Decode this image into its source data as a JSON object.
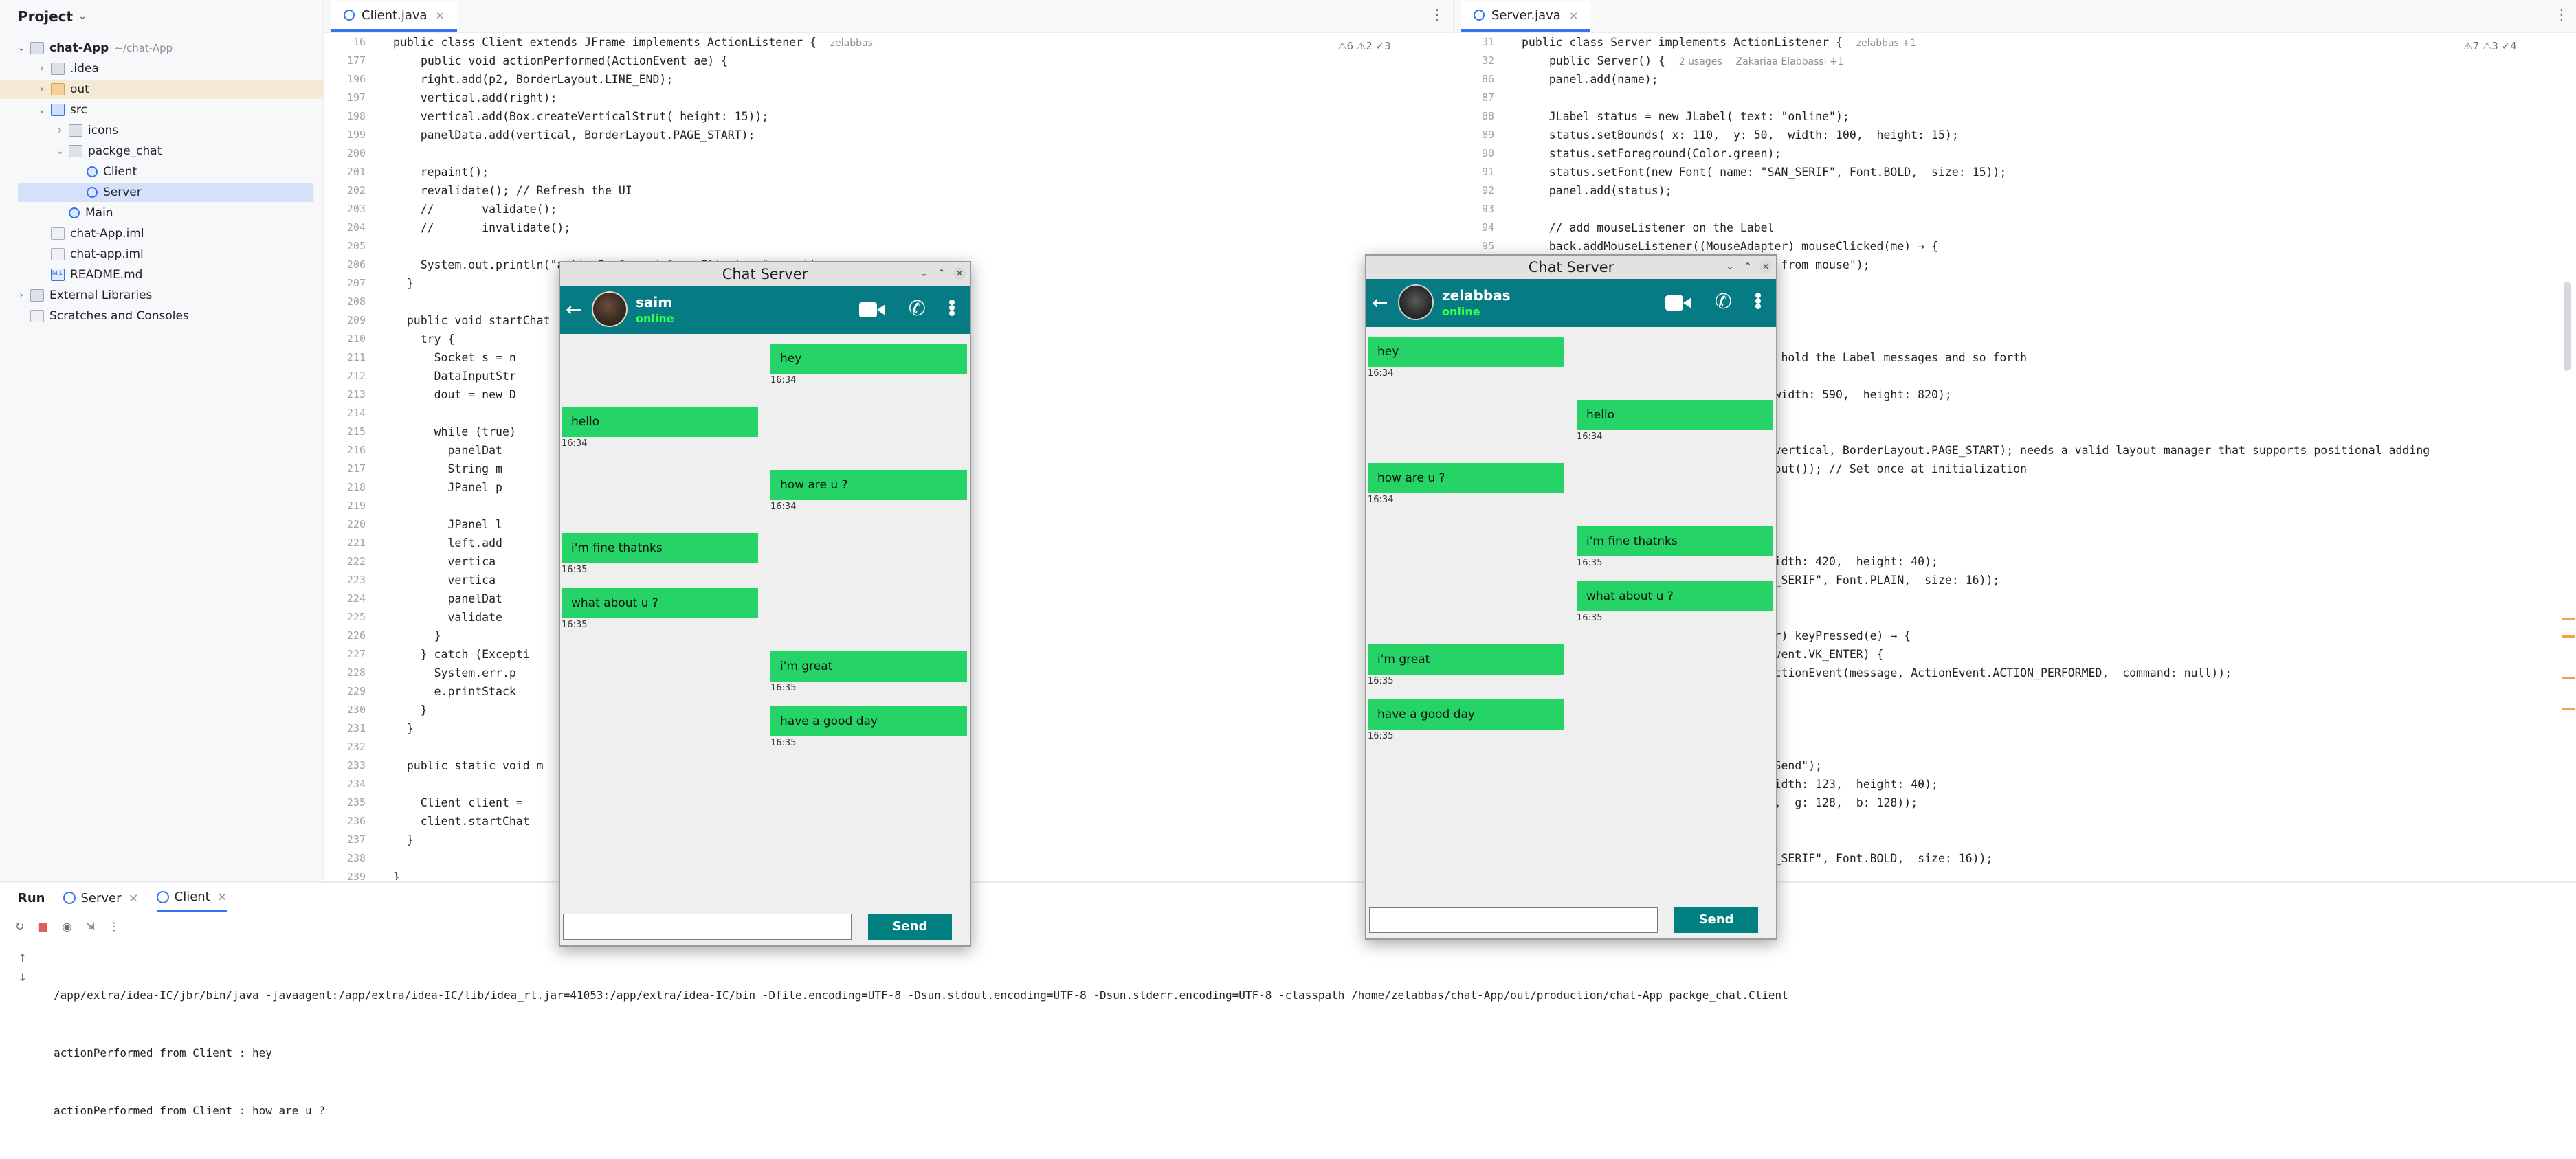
{
  "project": {
    "title": "Project",
    "items": [
      {
        "label": "chat-App",
        "hint": "~/chat-App"
      },
      {
        "label": ".idea"
      },
      {
        "label": "out"
      },
      {
        "label": "src"
      },
      {
        "label": "icons"
      },
      {
        "label": "packge_chat"
      },
      {
        "label": "Client"
      },
      {
        "label": "Server"
      },
      {
        "label": "Main"
      },
      {
        "label": "chat-App.iml"
      },
      {
        "label": "chat-app.iml"
      },
      {
        "label": "README.md"
      },
      {
        "label": "External Libraries"
      },
      {
        "label": "Scratches and Consoles"
      }
    ]
  },
  "left_editor": {
    "tab": "Client.java",
    "class_line": "public class Client extends JFrame implements ActionListener {",
    "class_author": "zelabbas",
    "method_line": "public void actionPerformed(ActionEvent ae) {",
    "inspections": "⚠6  ⚠2  ✓3",
    "lines": [
      {
        "n": "196",
        "t": "    right.add(p2, BorderLayout.LINE_END);"
      },
      {
        "n": "197",
        "t": "    vertical.add(right);"
      },
      {
        "n": "198",
        "t": "    vertical.add(Box.createVerticalStrut( height: 15));"
      },
      {
        "n": "199",
        "t": "    panelData.add(vertical, BorderLayout.PAGE_START);"
      },
      {
        "n": "200",
        "t": ""
      },
      {
        "n": "201",
        "t": "    repaint();"
      },
      {
        "n": "202",
        "t": "    revalidate(); // Refresh the UI"
      },
      {
        "n": "203",
        "t": "    //       validate();"
      },
      {
        "n": "204",
        "t": "    //       invalidate();"
      },
      {
        "n": "205",
        "t": ""
      },
      {
        "n": "206",
        "t": "    System.out.println(\"actionPerformed from Client : \" + out);"
      },
      {
        "n": "207",
        "t": "  }"
      },
      {
        "n": "208",
        "t": ""
      },
      {
        "n": "209",
        "t": "  public void startChat"
      },
      {
        "n": "210",
        "t": "    try {"
      },
      {
        "n": "211",
        "t": "      Socket s = n"
      },
      {
        "n": "212",
        "t": "      DataInputStr"
      },
      {
        "n": "213",
        "t": "      dout = new D"
      },
      {
        "n": "214",
        "t": ""
      },
      {
        "n": "215",
        "t": "      while (true)"
      },
      {
        "n": "216",
        "t": "        panelDat"
      },
      {
        "n": "217",
        "t": "        String m"
      },
      {
        "n": "218",
        "t": "        JPanel p"
      },
      {
        "n": "219",
        "t": ""
      },
      {
        "n": "220",
        "t": "        JPanel l"
      },
      {
        "n": "221",
        "t": "        left.add"
      },
      {
        "n": "222",
        "t": "        vertica"
      },
      {
        "n": "223",
        "t": "        vertica"
      },
      {
        "n": "224",
        "t": "        panelDat"
      },
      {
        "n": "225",
        "t": "        validate"
      },
      {
        "n": "226",
        "t": "      }"
      },
      {
        "n": "227",
        "t": "    } catch (Excepti"
      },
      {
        "n": "228",
        "t": "      System.err.p"
      },
      {
        "n": "229",
        "t": "      e.printStack"
      },
      {
        "n": "230",
        "t": "    }"
      },
      {
        "n": "231",
        "t": "  }"
      },
      {
        "n": "232",
        "t": ""
      },
      {
        "n": "233",
        "t": "  public static void m"
      },
      {
        "n": "234",
        "t": ""
      },
      {
        "n": "235",
        "t": "    Client client = "
      },
      {
        "n": "236",
        "t": "    client.startChat"
      },
      {
        "n": "237",
        "t": "  }"
      },
      {
        "n": "238",
        "t": ""
      },
      {
        "n": "239",
        "t": "}"
      }
    ]
  },
  "right_editor": {
    "tab": "Server.java",
    "class_line": "public class Server implements ActionListener {",
    "class_author": "zelabbas +1",
    "method_line": "public Server() {",
    "method_usages": "2 usages",
    "method_author": "Zakariaa Elabbassi +1",
    "inspections": "⚠7  ⚠3  ✓4",
    "lines": [
      {
        "n": "86",
        "t": "    panel.add(name);"
      },
      {
        "n": "87",
        "t": ""
      },
      {
        "n": "88",
        "t": "    JLabel status = new JLabel( text: \"online\");"
      },
      {
        "n": "89",
        "t": "    status.setBounds( x: 110,  y: 50,  width: 100,  height: 15);"
      },
      {
        "n": "90",
        "t": "    status.setForeground(Color.green);"
      },
      {
        "n": "91",
        "t": "    status.setFont(new Font( name: \"SAN_SERIF\", Font.BOLD,  size: 15));"
      },
      {
        "n": "92",
        "t": "    panel.add(status);"
      },
      {
        "n": "93",
        "t": ""
      },
      {
        "n": "94",
        "t": "    // add mouseListener on the Label"
      },
      {
        "n": "95",
        "t": "    back.addMouseListener((MouseAdapter) mouseClicked(me) → {"
      },
      {
        "n": "",
        "t": "                                 xist from mouse\");"
      },
      {
        "n": "",
        "t": ""
      },
      {
        "n": "",
        "t": ""
      },
      {
        "n": "",
        "t": ""
      },
      {
        "n": "",
        "t": ""
      },
      {
        "n": "",
        "t": "                                 will hold the Label messages and so forth"
      },
      {
        "n": "",
        "t": ""
      },
      {
        "n": "",
        "t": "                                 s,  width: 590,  height: 820);"
      },
      {
        "n": "",
        "t": ""
      },
      {
        "n": "",
        "t": ""
      },
      {
        "n": "",
        "t": "                                 add(vertical, BorderLayout.PAGE_START); needs a valid layout manager that supports positional adding"
      },
      {
        "n": "",
        "t": "                                 yLayout()); // Set once at initialization"
      },
      {
        "n": "",
        "t": ""
      },
      {
        "n": "",
        "t": ""
      },
      {
        "n": "",
        "t": ""
      },
      {
        "n": "",
        "t": ""
      },
      {
        "n": "",
        "t": "                                 ,  width: 420,  height: 40);"
      },
      {
        "n": "",
        "t": "                                 \"SAN_SERIF\", Font.PLAIN,  size: 16));"
      },
      {
        "n": "",
        "t": ""
      },
      {
        "n": "",
        "t": ""
      },
      {
        "n": "",
        "t": "                                 apter) keyPressed(e) → {"
      },
      {
        "n": "",
        "t": "                                 KeyEvent.VK_ENTER) {"
      },
      {
        "n": "",
        "t": "                                 ew ActionEvent(message, ActionEvent.ACTION_PERFORMED,  command: null));"
      },
      {
        "n": "",
        "t": ""
      },
      {
        "n": "",
        "t": ""
      },
      {
        "n": "",
        "t": ""
      },
      {
        "n": "",
        "t": ""
      },
      {
        "n": "",
        "t": "                                 t: \"Send\");"
      },
      {
        "n": "",
        "t": "                                 ,  width: 123,  height: 40);"
      },
      {
        "n": "",
        "t": "                                 r: 0,  g: 128,  b: 128));"
      },
      {
        "n": "",
        "t": "                                 );"
      },
      {
        "n": "",
        "t": "                                 );"
      },
      {
        "n": "",
        "t": "                                 \"SAN_SERIF\", Font.BOLD,  size: 16));"
      }
    ]
  },
  "bottom": {
    "run_label": "Run",
    "tabs": [
      "Server",
      "Client"
    ],
    "console": [
      "/app/extra/idea-IC/jbr/bin/java -javaagent:/app/extra/idea-IC/lib/idea_rt.jar=41053:/app/extra/idea-IC/bin -Dfile.encoding=UTF-8 -Dsun.stdout.encoding=UTF-8 -Dsun.stderr.encoding=UTF-8 -classpath /home/zelabbas/chat-App/out/production/chat-App packge_chat.Client",
      "actionPerformed from Client : hey",
      "actionPerformed from Client : how are u ?"
    ]
  },
  "chat_left": {
    "window_title": "Chat Server",
    "user": "saim",
    "status": "online",
    "send_label": "Send",
    "messages": [
      {
        "side": "right",
        "text": "hey",
        "time": "16:34"
      },
      {
        "side": "left",
        "text": "hello",
        "time": "16:34"
      },
      {
        "side": "right",
        "text": "how are u ?",
        "time": "16:34"
      },
      {
        "side": "left",
        "text": "i'm fine thatnks",
        "time": "16:35"
      },
      {
        "side": "left",
        "text": "what about u ?",
        "time": "16:35"
      },
      {
        "side": "right",
        "text": "i'm great",
        "time": "16:35"
      },
      {
        "side": "right",
        "text": "have a good day",
        "time": "16:35"
      }
    ]
  },
  "chat_right": {
    "window_title": "Chat Server",
    "user": "zelabbas",
    "status": "online",
    "send_label": "Send",
    "messages": [
      {
        "side": "left",
        "text": "hey",
        "time": "16:34"
      },
      {
        "side": "right",
        "text": "hello",
        "time": "16:34"
      },
      {
        "side": "left",
        "text": "how are u ?",
        "time": "16:34"
      },
      {
        "side": "right",
        "text": "i'm fine thatnks",
        "time": "16:35"
      },
      {
        "side": "right",
        "text": "what about u ?",
        "time": "16:35"
      },
      {
        "side": "left",
        "text": "i'm great",
        "time": "16:35"
      },
      {
        "side": "left",
        "text": "have a good day",
        "time": "16:35"
      }
    ]
  }
}
